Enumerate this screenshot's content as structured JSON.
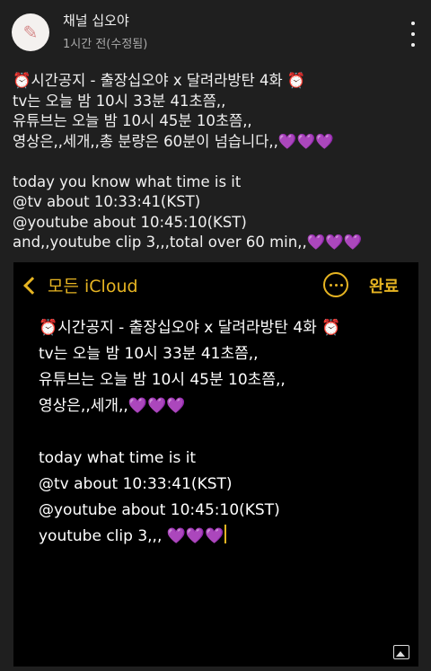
{
  "header": {
    "channel_name": "채널 십오야",
    "post_time": "1시간 전(수정됨)",
    "avatar_icon": "drawn-character-avatar",
    "more_icon": "vertical-ellipsis-icon"
  },
  "post": {
    "lines": [
      "⏰시간공지 - 출장십오야 x 달려라방탄 4화 ⏰",
      "tv는 오늘 밤 10시 33분 41초쯤,,",
      "유튜브는 오늘 밤 10시 45분 10초쯤,,",
      "영상은,,세개,,총 분량은 60분이 넘습니다,,💜💜💜",
      "",
      "today you know what time is it",
      "@tv about 10:33:41(KST)",
      "@youtube about 10:45:10(KST)",
      "and,,youtube clip 3,,,total over 60 min,,💜💜💜"
    ]
  },
  "screenshot": {
    "back_label": "모든 iCloud",
    "done_label": "완료",
    "accent_color": "#e6b422",
    "note_lines": [
      "⏰시간공지 - 출장십오야 x 달려라방탄 4화 ⏰",
      "tv는 오늘 밤 10시 33분 41초쯤,,",
      "유튜브는 오늘 밤 10시 45분 10초쯤,,",
      "영상은,,세개,,💜💜💜",
      "",
      "today what time is it",
      "@tv about 10:33:41(KST)",
      "@youtube about 10:45:10(KST)",
      "youtube clip 3,,, 💜💜💜"
    ]
  }
}
